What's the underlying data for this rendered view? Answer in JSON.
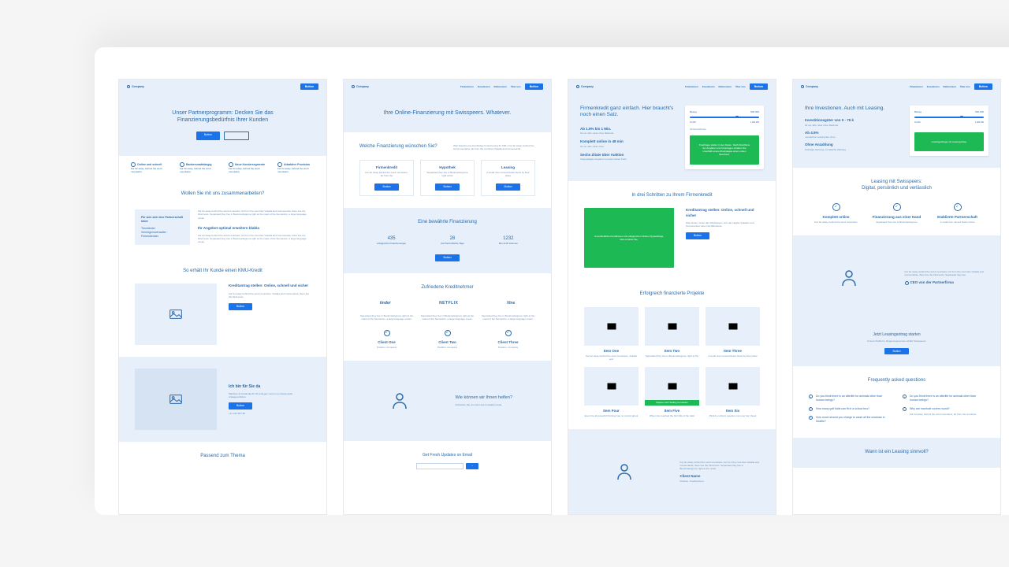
{
  "meta": {
    "brand": "Company"
  },
  "nav": {
    "items": [
      "Finanzieren",
      "Investieren",
      "Referenzen",
      "Über uns"
    ],
    "cta": "Button"
  },
  "pages": [
    {
      "id": "partner",
      "hero": {
        "title": "Unser Partnerprogramm: Decken Sie das Finanzierungsbedürfnis Ihrer Kunden",
        "primary": "Button",
        "secondary": ""
      },
      "features": [
        {
          "title": "Online und schnell",
          "text": "Far far away, behind the word mountains"
        },
        {
          "title": "Bankenunabhängig",
          "text": "Far far away, behind the word mountains"
        },
        {
          "title": "Neue Kundersegmente",
          "text": "Far far away, behind the word mountains"
        },
        {
          "title": "Attraktive Provision",
          "text": "Far far away, behind the word mountains"
        }
      ],
      "collab": {
        "title": "Wollen Sie mit uns zusammenarbeiten?",
        "card": {
          "title": "Für wen sich eine Partnerschaft lohnt",
          "lines": [
            "Treuhänder",
            "Vermögensverwalter",
            "Firmenberater"
          ]
        },
        "sub1": "Ihr Angebot optimal erweitern blabla",
        "body": "Far far away behind the word mountains, far from the countries Vokalia and Consonantia, there live the blind texts. Separated they live in Bookmarksgrove right at the coast of the Semantics, a large language ocean."
      },
      "kmu": {
        "title": "So erhält Ihr Kunde einen KMU-Kredit",
        "block_title": "Kreditantrag stellen: Online, schnell und sicher",
        "block_text": "Far far away behind the word mountains, Vokalia and Consonantia, there live the blind texts."
      },
      "contact": {
        "title": "Ich bin für Sie da",
        "text": "Matthias ist zuständig für Ihr Anliegen rund um professionelle Anlageportfolios.",
        "btn": "Button",
        "phone": "+41 234 567 89"
      },
      "related": {
        "title": "Passend zum Thema"
      }
    },
    {
      "id": "online-finanzierung",
      "hero": {
        "title": "Ihre Online-Finanzierung mit Swisspeers. Whatever."
      },
      "choose": {
        "title": "Welche Finanzierung wünschen Sie?",
        "text": "Was braucht eine kurzfristige Finanzierung für KMU. Far far away, behind the word mountains, far from the countries Vokalia and Consonantia.",
        "cards": [
          {
            "title": "Firmenkredit",
            "text": "Far far away behind the word mountains, far from the"
          },
          {
            "title": "Hypothek",
            "text": "Separated they live in Bookmarksgrove right at the"
          },
          {
            "title": "Leasing",
            "text": "A small river named Duden flows by their place"
          }
        ]
      },
      "proven": {
        "title": "Eine bewährte Finanzierung",
        "stats": [
          {
            "n": "435",
            "l": "erfolgreiche Finanzierungen"
          },
          {
            "n": "28",
            "l": "durchschnittliche Tage"
          },
          {
            "n": "1232",
            "l": "Mio CHF Volumen"
          }
        ],
        "btn": "Button"
      },
      "testimonials": {
        "title": "Zufriedene Kreditnehmer",
        "logos": [
          "tinder",
          "NETFLIX",
          "Vine"
        ],
        "quote": "Separated they live in Bookmarksgrove right at the coast of the Semantics, a large language ocean.",
        "clients": [
          {
            "name": "Client One",
            "pos": "Position, Company"
          },
          {
            "name": "Client Two",
            "pos": "Position, Company"
          },
          {
            "name": "Client Three",
            "pos": "Position, Company"
          }
        ]
      },
      "help": {
        "title": "Wie können wir Ihnen helfen?",
        "sub": "Schreiben Sie uns über das Kontaktformular"
      },
      "newsletter": {
        "title": "Get Fresh Updates on Email"
      }
    },
    {
      "id": "firmenkredit",
      "hero": {
        "title": "Firmenkredit ganz einfach. Hier braucht's noch einen Satz.",
        "bullets": [
          {
            "t": "Ab 1.5% bis 1 Mio.",
            "s": "für ein Jahr, aber ohne Maximal."
          },
          {
            "t": "Komplett online in 48 min",
            "s": "für ein Jahr, aber ohne"
          },
          {
            "t": "Sechs Zitate über Auktion",
            "s": "Vorgeprägtes Angebot zu einem fairen Preis"
          }
        ],
        "slider": {
          "label": "Betrag",
          "min": "10,000",
          "max": "1,000,000",
          "value": "500,000",
          "range_label": "Zinsbrandbreite"
        },
        "greenbox": "Kreditrage stellen in den Daten. Nach Abschluss der Angaben und Unterlagen erhalten Sie innerhalb eines Arbeitstages einen ersten Bescheid."
      },
      "steps": {
        "title": "In drei Schritten zu Ihrem Firmenkredit",
        "green": "Unverbindliche Konditionen mit erfolgreichen Online-Tippsanfrage. Das erwartet Sie.",
        "block_title": "Kreditantrag stellen: Online, schnell und sicher",
        "block_text": "Weit hinten, hinter den Wortbergen, fern der Länder Vokalien und Konsonantien leben die Blindtexte.",
        "btn": "Button"
      },
      "projects": {
        "title": "Erfolgreich finanzierte Projekte",
        "items": [
          {
            "title": "Item One",
            "text": "Far far away behind the word mountains, Vokalia and"
          },
          {
            "title": "Item Two",
            "text": "Separated they live in Bookmarksgrove right at the"
          },
          {
            "title": "Item Three",
            "text": "A small river named Duden flows by their place"
          },
          {
            "title": "Item Four",
            "text": "Even the all-powerful Pointing has no control about"
          },
          {
            "title": "Item Five",
            "text": "When she reached the first hills of the Italic"
          },
          {
            "title": "Item Six",
            "text": "Pityful a rethoric question ran over her cheek"
          }
        ],
        "green_label": "Objektes nach Handling und Geldern"
      },
      "help": {
        "text": "Far far away, behind the word mountains, far from the countries Vokalia and Consonantia, there live the blind texts. Separated they live in Bookmarksgrove right at the coast.",
        "name": "Client Name",
        "pos": "Position, Kreditnehmer"
      }
    },
    {
      "id": "leasing",
      "hero": {
        "title": "Ihre Investionen. Auch mit Leasing.",
        "bullets": [
          {
            "t": "Investitionsgüter von 0 - 75 k",
            "s": "für ein Jahr, aber ohne Maximal."
          },
          {
            "t": "Ab 4.5%",
            "s": "monatliche Leasingrate ohne"
          },
          {
            "t": "Ohne Anzahlung",
            "s": "Sofortige Nutzung, monatliche Zahlung"
          }
        ],
        "slider": {
          "label": "Betrag",
          "min": "10,000",
          "max": "1,000,000",
          "value": "500,000"
        },
        "greenbox": "Leasinganfrage mit Leasing-Diag."
      },
      "digital": {
        "title": "Leasing mit Swisspeers:",
        "subtitle": "Digital, persönlich und verlässlich",
        "cols": [
          {
            "title": "Komplett online",
            "text": "Far far away, behind the word mountains"
          },
          {
            "title": "Finanzierung aus einer Hand",
            "text": "Separated they live in Bookmarksgrove"
          },
          {
            "title": "Etablierte Partnerschaft",
            "text": "A small river named Duden flows"
          }
        ]
      },
      "quote": {
        "text": "Far far away, behind the word mountains, far from the countries Vokalia and Consonantia, there live the blind texts. Separated they live.",
        "name": "CEO von der Partnerfirma"
      },
      "cta": {
        "title": "Jetzt Leasingantrag starten",
        "sub": "Unsere Plattform, Regierungsservice erklärt Swisspeers.",
        "btn": "Button"
      },
      "faq": {
        "title": "Frequently asked questions",
        "left": [
          "Do you think there is an afterlife for animals other than human beings?",
          "How many golf balls can fit in a school bus?",
          "How much should you charge to wash all the windows in Seattle?"
        ],
        "right": [
          {
            "q": "Do you think there is an afterlife for animals other than human beings?",
            "a": ""
          },
          {
            "q": "Why are manhole covers round?",
            "a": "Far far away, behind the word mountains, far from the countries."
          }
        ]
      },
      "sinnvoll": {
        "title": "Wann ist ein Leasing sinnvoll?"
      }
    }
  ]
}
